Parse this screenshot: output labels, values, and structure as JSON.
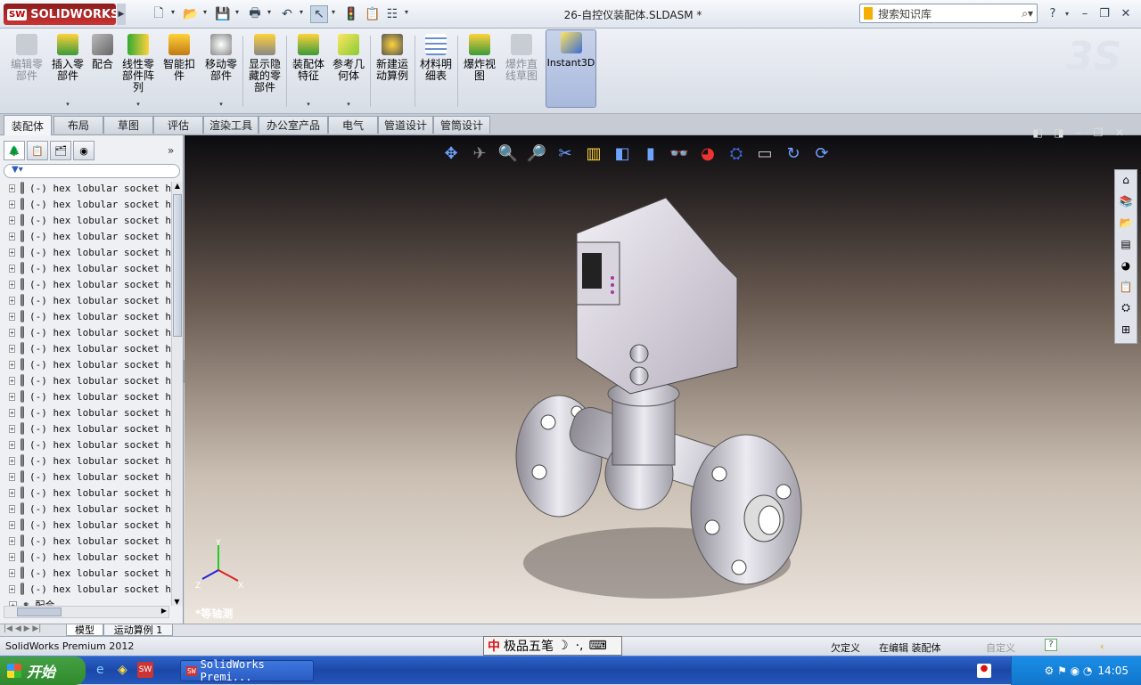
{
  "app": {
    "name": "SOLIDWORKS",
    "logo_mark": "3S"
  },
  "titlebar": {
    "document_title": "26-自控仪装配体.SLDASM *",
    "search_placeholder": "搜索知识库",
    "help": "?"
  },
  "ribbon": {
    "buttons": [
      {
        "label": "编辑零部件",
        "icon": "edit-component-icon",
        "disabled": true
      },
      {
        "label": "插入零部件",
        "icon": "insert-component-icon",
        "disabled": false
      },
      {
        "label": "配合",
        "icon": "mate-icon",
        "disabled": false
      },
      {
        "label": "线性零部件阵列",
        "icon": "linear-pattern-icon",
        "disabled": false
      },
      {
        "label": "智能扣件",
        "icon": "smart-fastener-icon",
        "disabled": false
      },
      {
        "label": "移动零部件",
        "icon": "move-component-icon",
        "disabled": false
      },
      {
        "label": "显示隐藏的零部件",
        "icon": "show-hidden-icon",
        "disabled": false
      },
      {
        "label": "装配体特征",
        "icon": "assembly-feature-icon",
        "disabled": false
      },
      {
        "label": "参考几何体",
        "icon": "reference-geometry-icon",
        "disabled": false
      },
      {
        "label": "新建运动算例",
        "icon": "motion-study-icon",
        "disabled": false
      },
      {
        "label": "材料明细表",
        "icon": "bom-icon",
        "disabled": false
      },
      {
        "label": "爆炸视图",
        "icon": "exploded-view-icon",
        "disabled": false
      },
      {
        "label": "爆炸直线草图",
        "icon": "explode-line-icon",
        "disabled": true
      },
      {
        "label": "Instant3D",
        "icon": "instant3d-icon",
        "disabled": false
      }
    ]
  },
  "tabs": [
    "装配体",
    "布局",
    "草图",
    "评估",
    "渲染工具",
    "办公室产品",
    "电气",
    "管道设计",
    "管筒设计"
  ],
  "tree": {
    "filter_icon": "filter-icon",
    "rows": [
      "(-) hex lobular socket h",
      "(-) hex lobular socket h",
      "(-) hex lobular socket h",
      "(-) hex lobular socket h",
      "(-) hex lobular socket h",
      "(-) hex lobular socket h",
      "(-) hex lobular socket h",
      "(-) hex lobular socket h",
      "(-) hex lobular socket h",
      "(-) hex lobular socket h",
      "(-) hex lobular socket h",
      "(-) hex lobular socket h",
      "(-) hex lobular socket h",
      "(-) hex lobular socket h",
      "(-) hex lobular socket h",
      "(-) hex lobular socket h",
      "(-) hex lobular socket h",
      "(-) hex lobular socket h",
      "(-) hex lobular socket h",
      "(-) hex lobular socket h",
      "(-) hex lobular socket h",
      "(-) hex lobular socket h",
      "(-) hex lobular socket h",
      "(-) hex lobular socket h",
      "(-) hex lobular socket h",
      "(-) hex lobular socket h"
    ],
    "last_row": "配合"
  },
  "viewport": {
    "view_label": "*等轴测",
    "axis_x": "X",
    "axis_y": "Y",
    "axis_z": "Z"
  },
  "bottom_tabs": [
    "模型",
    "运动算例 1"
  ],
  "status": {
    "app_version": "SolidWorks Premium 2012",
    "ime": "极品五笔",
    "state1": "欠定义",
    "state2": "在编辑 装配体",
    "custom": "自定义"
  },
  "taskbar": {
    "start": "开始",
    "task": "SolidWorks Premi...",
    "clock": "14:05"
  },
  "colors": {
    "accent": "#2a5cc3",
    "brand": "#c33333"
  }
}
